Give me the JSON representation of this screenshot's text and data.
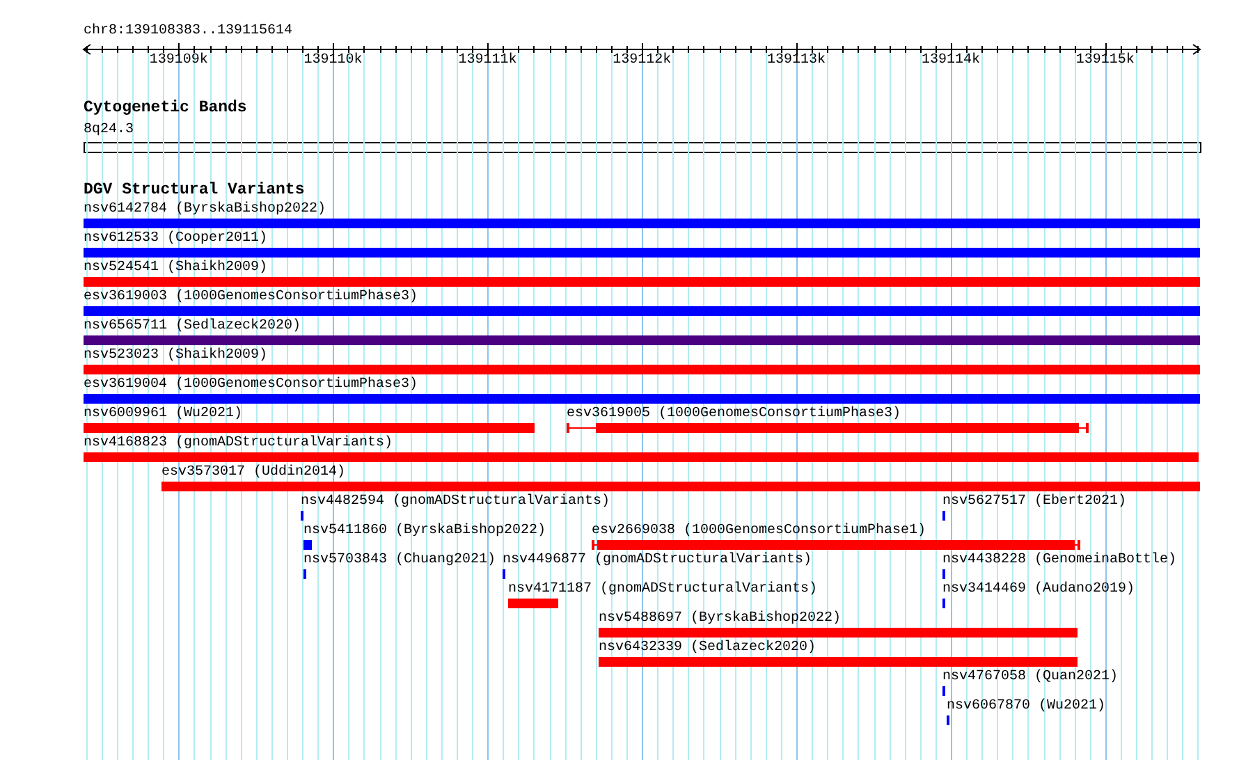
{
  "location": "chr8:139108383..139115614",
  "ruler": {
    "ticks": [
      {
        "label": "139109k"
      },
      {
        "label": "139110k"
      },
      {
        "label": "139111k"
      },
      {
        "label": "139112k"
      },
      {
        "label": "139113k"
      },
      {
        "label": "139114k"
      },
      {
        "label": "139115k"
      }
    ]
  },
  "cytogenetic_bands": {
    "title": "Cytogenetic Bands",
    "band": "8q24.3"
  },
  "dgv_track": {
    "title": "DGV Structural Variants",
    "rows": [
      {
        "features": [
          {
            "label": "nsv6142784 (ByrskaBishop2022)",
            "color": "#0000ff"
          }
        ]
      },
      {
        "features": [
          {
            "label": "nsv612533 (Cooper2011)",
            "color": "#0000ff"
          }
        ]
      },
      {
        "features": [
          {
            "label": "nsv524541 (Shaikh2009)",
            "color": "#ff0000"
          }
        ]
      },
      {
        "features": [
          {
            "label": "esv3619003 (1000GenomesConsortiumPhase3)",
            "color": "#0000ff"
          }
        ]
      },
      {
        "features": [
          {
            "label": "nsv6565711 (Sedlazeck2020)",
            "color": "#4b0082"
          }
        ]
      },
      {
        "features": [
          {
            "label": "nsv523023 (Shaikh2009)",
            "color": "#ff0000"
          }
        ]
      },
      {
        "features": [
          {
            "label": "esv3619004 (1000GenomesConsortiumPhase3)",
            "color": "#0000ff"
          }
        ]
      },
      {
        "features": [
          {
            "label": "nsv6009961 (Wu2021)",
            "color": "#ff0000"
          },
          {
            "label": "esv3619005 (1000GenomesConsortiumPhase3)",
            "color": "#ff0000"
          }
        ]
      },
      {
        "features": [
          {
            "label": "nsv4168823 (gnomADStructuralVariants)",
            "color": "#ff0000"
          }
        ]
      },
      {
        "features": [
          {
            "label": "esv3573017 (Uddin2014)",
            "color": "#ff0000"
          }
        ]
      },
      {
        "features": [
          {
            "label": "nsv4482594 (gnomADStructuralVariants)",
            "color": "#0000ff"
          },
          {
            "label": "nsv5627517 (Ebert2021)",
            "color": "#0000ff"
          }
        ]
      },
      {
        "features": [
          {
            "label": "nsv5411860 (ByrskaBishop2022)",
            "color": "#0000ff"
          },
          {
            "label": "esv2669038 (1000GenomesConsortiumPhase1)",
            "color": "#ff0000"
          }
        ]
      },
      {
        "features": [
          {
            "label": "nsv5703843 (Chuang2021)",
            "color": "#0000ff"
          },
          {
            "label": "nsv4496877 (gnomADStructuralVariants)",
            "color": "#0000ff"
          },
          {
            "label": "nsv4438228 (GenomeinaBottle)",
            "color": "#0000ff"
          }
        ]
      },
      {
        "features": [
          {
            "label": "nsv4171187 (gnomADStructuralVariants)",
            "color": "#ff0000"
          },
          {
            "label": "nsv3414469 (Audano2019)",
            "color": "#0000ff"
          }
        ]
      },
      {
        "features": [
          {
            "label": "nsv5488697 (ByrskaBishop2022)",
            "color": "#ff0000"
          }
        ]
      },
      {
        "features": [
          {
            "label": "nsv6432339 (Sedlazeck2020)",
            "color": "#ff0000"
          }
        ]
      },
      {
        "features": [
          {
            "label": "nsv4767058 (Quan2021)",
            "color": "#0000ff"
          }
        ]
      },
      {
        "features": [
          {
            "label": "nsv6067870 (Wu2021)",
            "color": "#0000ff"
          }
        ]
      }
    ]
  }
}
